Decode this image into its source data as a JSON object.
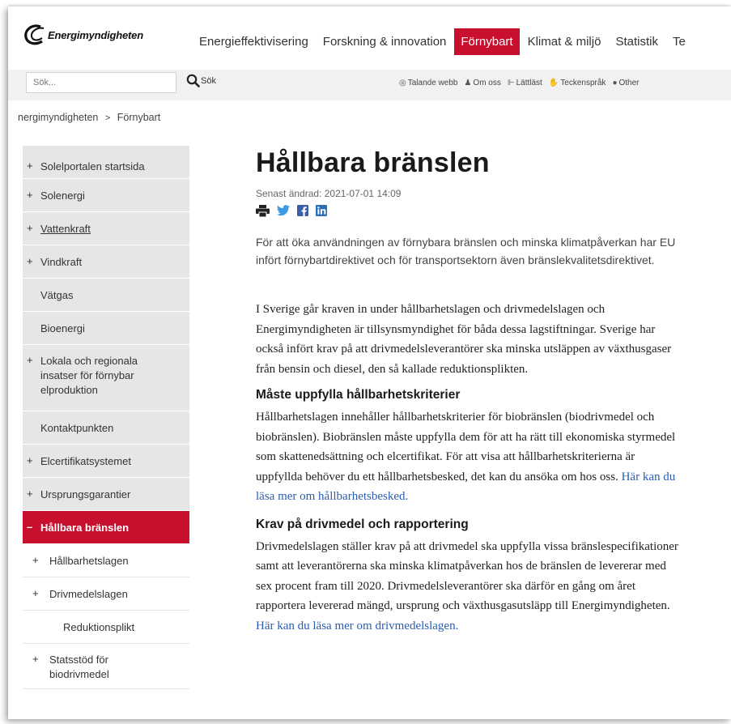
{
  "brand": {
    "name": "Energimyndigheten",
    "accent": "#c8102e"
  },
  "nav": {
    "items": [
      "Energieffektivisering",
      "Forskning & innovation",
      "Förnybart",
      "Klimat & miljö",
      "Statistik",
      "Te"
    ],
    "active_index": 2
  },
  "search": {
    "placeholder": "Sök...",
    "button_label": "Sök"
  },
  "utility": [
    {
      "icon": "speaker-icon",
      "label": "Talande webb"
    },
    {
      "icon": "person-icon",
      "label": "Om oss"
    },
    {
      "icon": "easy-read-icon",
      "label": "Lättläst"
    },
    {
      "icon": "sign-language-icon",
      "label": "Teckenspråk"
    },
    {
      "icon": "speech-bubble-icon",
      "label": "Other"
    }
  ],
  "breadcrumb": {
    "home": "nergimyndigheten",
    "separator": ">",
    "current": "Förnybart"
  },
  "sidebar": {
    "items": [
      {
        "prefix": "+",
        "label": "Solelportalen startsida"
      },
      {
        "prefix": "+",
        "label": "Solenergi"
      },
      {
        "prefix": "+",
        "label": "Vattenkraft"
      },
      {
        "prefix": "+",
        "label": "Vindkraft"
      },
      {
        "prefix": "",
        "label": "Vätgas"
      },
      {
        "prefix": "",
        "label": "Bioenergi"
      },
      {
        "prefix": "+",
        "label": "Lokala och regionala insatser för förnybar elproduktion"
      },
      {
        "prefix": "",
        "label": "Kontaktpunkten"
      },
      {
        "prefix": "+",
        "label": "Elcertifikatsystemet"
      },
      {
        "prefix": "+",
        "label": "Ursprungsgarantier"
      },
      {
        "prefix": "–",
        "label": "Hållbara bränslen"
      },
      {
        "prefix": "+",
        "label": "Hållbarhetslagen"
      },
      {
        "prefix": "+",
        "label": "Drivmedelslagen"
      },
      {
        "prefix": "",
        "label": "Reduktionsplikt"
      },
      {
        "prefix": "+",
        "label": "Statsstöd för biodrivmedel"
      }
    ]
  },
  "article": {
    "title": "Hållbara bränslen",
    "updated": "Senast ändrad: 2021-07-01 14:09",
    "share_icons": [
      "print-icon",
      "twitter-icon",
      "facebook-icon",
      "linkedin-icon"
    ],
    "intro": "För att öka användningen av förnybara bränslen och minska klimatpåverkan har EU infört förnybartdirektivet och för transportsektorn även bränslekvalitetsdirektivet.",
    "para1": "I Sverige går kraven in under hållbarhetslagen och drivmedelslagen och Energimyndigheten är tillsynsmyndighet för båda dessa lagstiftningar. Sverige har också infört krav på att drivmedelsleverantörer ska minska utsläppen av växthusgaser från bensin och diesel, den så kallade reduktionsplikten.",
    "heading1": "Måste uppfylla hållbarhetskriterier",
    "para2": "Hållbarhetslagen innehåller hållbarhetskriterier för biobränslen (biodrivmedel och biobränslen). Biobränslen måste uppfylla dem för att ha rätt till ekonomiska styrmedel som skattenedsättning och elcertifikat. För att visa att hållbarhetskriterierna är uppfyllda behöver du ett hållbarhetsbesked, det kan du ansöka om hos oss.",
    "link1": "Här kan du läsa mer om hållbarhetsbesked.",
    "heading2": "Krav på drivmedel och rapportering",
    "para3": "Drivmedelslagen ställer krav på att drivmedel ska uppfylla vissa bränslespecifikationer samt att leverantörerna ska minska klimatpåverkan hos de bränslen de levererar med sex procent fram till 2020. Drivmedelsleverantörer ska därför en gång om året rapportera levererad mängd, ursprung och växthusgasutsläpp till Energimyndigheten.",
    "link2": "Här kan du läsa mer om drivmedelslagen."
  }
}
